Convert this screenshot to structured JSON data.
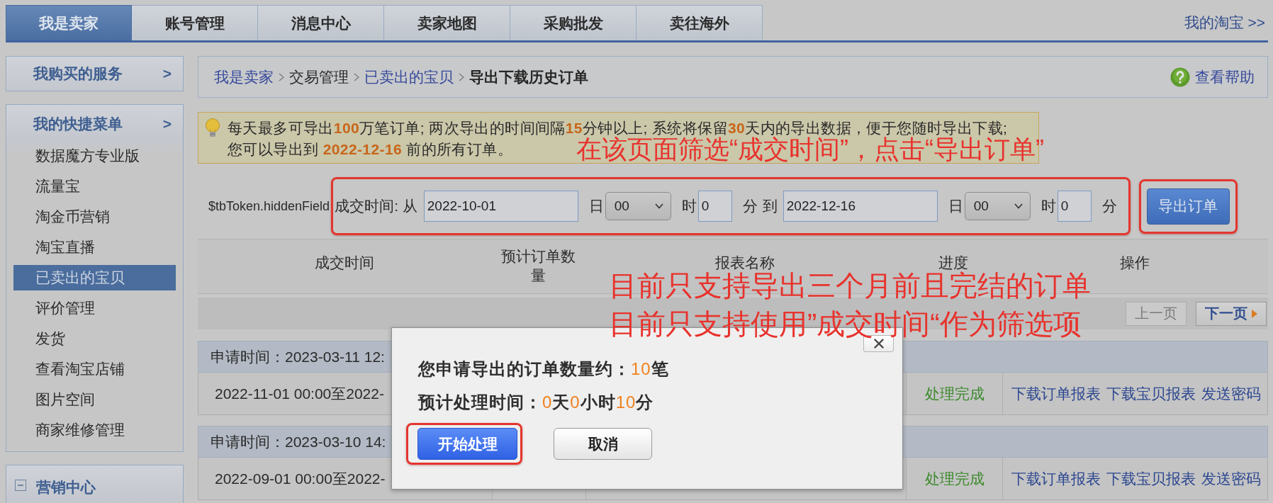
{
  "top_nav": {
    "tabs": [
      {
        "label": "我是卖家",
        "selected": true
      },
      {
        "label": "账号管理",
        "selected": false
      },
      {
        "label": "消息中心",
        "selected": false
      },
      {
        "label": "卖家地图",
        "selected": false
      },
      {
        "label": "采购批发",
        "selected": false
      },
      {
        "label": "卖往海外",
        "selected": false
      }
    ],
    "link": "我的淘宝 >>"
  },
  "sidebar": {
    "services": {
      "title": "我购买的服务",
      "arrow": ">"
    },
    "quick_menu": {
      "title": "我的快捷菜单",
      "arrow": ">",
      "items": [
        {
          "label": "数据魔方专业版",
          "selected": false
        },
        {
          "label": "流量宝",
          "selected": false
        },
        {
          "label": "淘金币营销",
          "selected": false
        },
        {
          "label": "淘宝直播",
          "selected": false
        },
        {
          "label": "已卖出的宝贝",
          "selected": true
        },
        {
          "label": "评价管理",
          "selected": false
        },
        {
          "label": "发货",
          "selected": false
        },
        {
          "label": "查看淘宝店铺",
          "selected": false
        },
        {
          "label": "图片空间",
          "selected": false
        },
        {
          "label": "商家维修管理",
          "selected": false
        }
      ]
    },
    "marketing": {
      "title": "营销中心"
    }
  },
  "breadcrumb": {
    "items": [
      {
        "label": "我是卖家",
        "kind": "link"
      },
      {
        "label": "交易管理",
        "kind": "text"
      },
      {
        "label": "已卖出的宝贝",
        "kind": "link"
      },
      {
        "label": "导出下载历史订单",
        "kind": "current"
      }
    ],
    "help": "查看帮助"
  },
  "notice": {
    "lines": [
      "每天最多可导出**100**万笔订单; 两次导出的时间间隔**15**分钟以上; 系统将保留**30**天内的导出数据，便于您随时导出下载;",
      "您可以导出到 **2022-12-16** 前的所有订单。"
    ]
  },
  "filter": {
    "hidden_field": "$tbToken.hiddenField",
    "label": "成交时间: 从",
    "highlighted": true,
    "from": {
      "date": "2022-10-01",
      "day_unit": "日",
      "hour": "00",
      "hour_unit": "时",
      "minute": "0",
      "minute_unit": "分"
    },
    "to_label": "到",
    "to": {
      "date": "2022-12-16",
      "day_unit": "日",
      "hour": "00",
      "hour_unit": "时",
      "minute": "0",
      "minute_unit": "分"
    },
    "export_button": {
      "label": "导出订单",
      "highlighted": true
    }
  },
  "table": {
    "columns": [
      "成交时间",
      "预计订单数量",
      "报表名称",
      "进度",
      "操作"
    ]
  },
  "pager": {
    "prev": {
      "label": "上一页",
      "disabled": true
    },
    "next": {
      "label": "下一页",
      "disabled": false
    }
  },
  "records": [
    {
      "request_time": "申请时间：2023-03-11 12:",
      "range": "2022-11-01 00:00至2022-",
      "status": "处理完成",
      "actions": [
        "下载订单报表",
        "下载宝贝报表",
        "发送密码"
      ]
    },
    {
      "request_time": "申请时间：2023-03-10 14:",
      "range": "2022-09-01 00:00至2022-",
      "status": "处理完成",
      "actions": [
        "下载订单报表",
        "下载宝贝报表",
        "发送密码"
      ]
    }
  ],
  "dialog": {
    "lines": [
      [
        {
          "text": "您申请导出的订单数量约：",
          "kind": "label"
        },
        {
          "text": "10",
          "kind": "value"
        },
        {
          "text": "笔",
          "kind": "label"
        }
      ],
      [
        {
          "text": "预计处理时间：",
          "kind": "label"
        },
        {
          "text": "0",
          "kind": "value"
        },
        {
          "text": "天",
          "kind": "label"
        },
        {
          "text": "0",
          "kind": "value"
        },
        {
          "text": "小时",
          "kind": "label"
        },
        {
          "text": "10",
          "kind": "value"
        },
        {
          "text": "分",
          "kind": "label"
        }
      ]
    ],
    "buttons": [
      {
        "label": "开始处理",
        "kind": "primary",
        "highlighted": true
      },
      {
        "label": "取消",
        "kind": "secondary",
        "highlighted": false
      }
    ]
  },
  "annotations": [
    "在该页面筛选“成交时间”，点击“导出订单”",
    "目前只支持导出三个月前且完结的订单",
    "目前只支持使用”成交时间“作为筛选项"
  ]
}
